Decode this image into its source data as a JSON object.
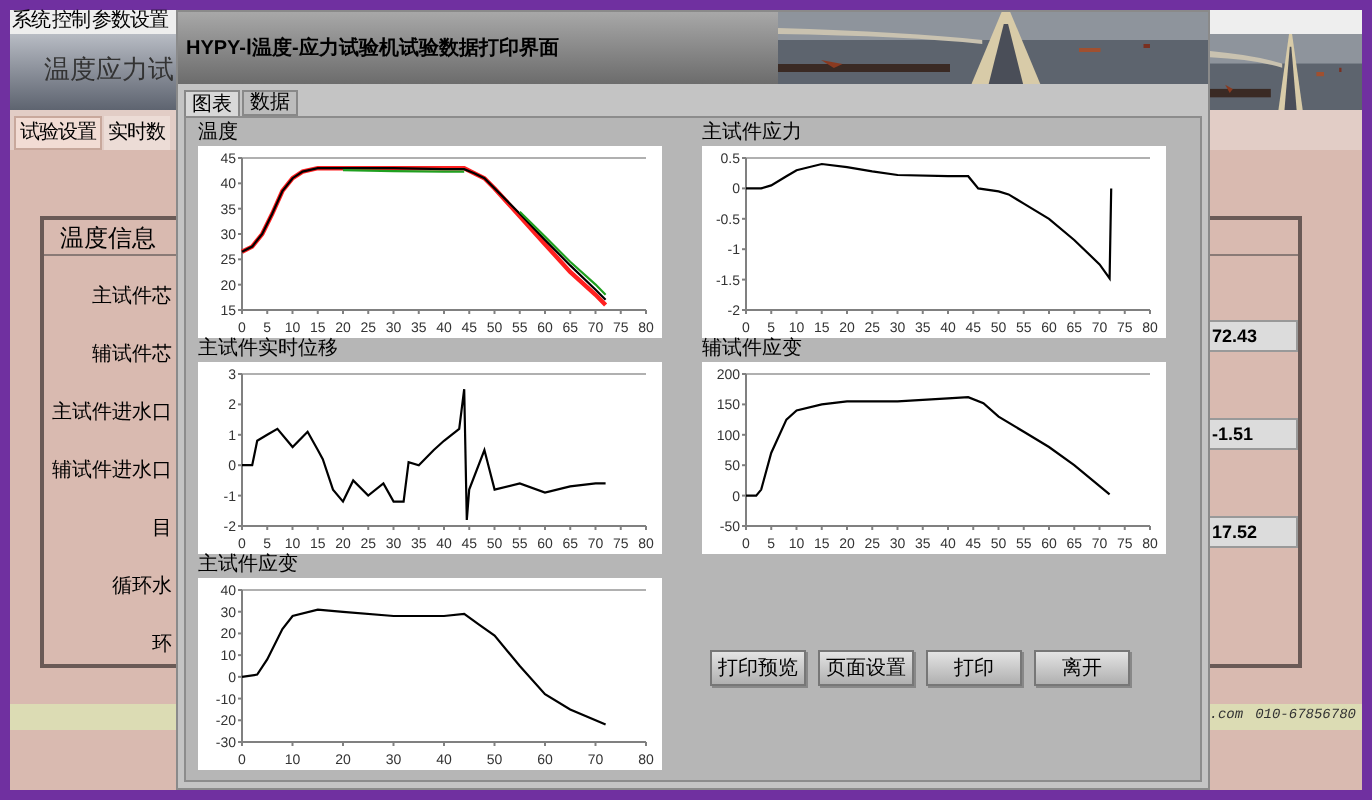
{
  "background_app": {
    "menu": [
      "系统",
      "控制",
      "参数设置"
    ],
    "title": "温度应力试",
    "tabs": [
      {
        "label": "试验设置",
        "selected": true
      },
      {
        "label": "实时数",
        "selected": false
      }
    ],
    "group_title": "温度信息",
    "labels": [
      "主试件芯",
      "辅试件芯",
      "主试件进水口",
      "辅试件进水口",
      "目",
      "循环水",
      "环"
    ],
    "values": [
      "72.43",
      "-1.51",
      "17.52"
    ],
    "status_bar": [
      ".com",
      "010-67856780"
    ]
  },
  "dialog": {
    "title": "HYPY-Ⅰ温度-应力试验机试验数据打印界面",
    "tabs": [
      {
        "label": "图表",
        "selected": true
      },
      {
        "label": "数据",
        "selected": false
      }
    ],
    "charts": [
      {
        "chart_data": {
          "type": "line",
          "title": "温度",
          "x": [
            0,
            2,
            4,
            6,
            8,
            10,
            12,
            15,
            20,
            30,
            40,
            44,
            46,
            48,
            50,
            55,
            60,
            65,
            70,
            72
          ],
          "series": [
            {
              "color": "#ff2020",
              "values": [
                26.5,
                27.5,
                30,
                34,
                38.5,
                41,
                42.3,
                43,
                43,
                43,
                43,
                43,
                42,
                41,
                39,
                33.5,
                28,
                22.5,
                18,
                16
              ]
            },
            {
              "color": "#000000",
              "values": [
                26.5,
                27.5,
                30,
                34,
                38.5,
                41,
                42.3,
                43,
                43,
                43,
                42.8,
                42.8,
                42,
                41,
                39,
                34,
                28.8,
                23.8,
                19,
                17
              ]
            },
            {
              "color": "#20a020",
              "values": [
                null,
                null,
                null,
                null,
                null,
                null,
                null,
                null,
                42.6,
                42.4,
                42.3,
                42.3,
                null,
                null,
                null,
                34.4,
                29.5,
                24.5,
                20,
                18
              ]
            }
          ],
          "xlim": [
            0,
            80
          ],
          "ylim": [
            15,
            45
          ],
          "xticks": [
            0,
            5,
            10,
            15,
            20,
            25,
            30,
            35,
            40,
            45,
            50,
            55,
            60,
            65,
            70,
            75,
            80
          ],
          "yticks": [
            15,
            20,
            25,
            30,
            35,
            40,
            45
          ]
        }
      },
      {
        "chart_data": {
          "type": "line",
          "title": "主试件实时位移",
          "x": [
            0,
            2,
            3,
            5,
            7,
            10,
            13,
            15,
            16,
            18,
            20,
            22,
            25,
            28,
            30,
            32,
            33,
            35,
            38,
            40,
            43,
            44,
            44.5,
            45,
            48,
            50,
            55,
            60,
            65,
            70,
            72
          ],
          "series": [
            {
              "color": "#000000",
              "values": [
                0,
                0,
                0.8,
                1.0,
                1.2,
                0.6,
                1.1,
                0.5,
                0.2,
                -0.8,
                -1.2,
                -0.5,
                -1.0,
                -0.6,
                -1.2,
                -1.2,
                0.1,
                0,
                0.5,
                0.8,
                1.2,
                2.5,
                -1.8,
                -0.8,
                0.5,
                -0.8,
                -0.6,
                -0.9,
                -0.7,
                -0.6,
                -0.6
              ]
            }
          ],
          "xlim": [
            0,
            80
          ],
          "ylim": [
            -2,
            3
          ],
          "xticks": [
            0,
            5,
            10,
            15,
            20,
            25,
            30,
            35,
            40,
            45,
            50,
            55,
            60,
            65,
            70,
            75,
            80
          ],
          "yticks": [
            -2,
            -1,
            0,
            1,
            2,
            3
          ]
        }
      },
      {
        "chart_data": {
          "type": "line",
          "title": "主试件应变",
          "x": [
            0,
            3,
            5,
            8,
            10,
            15,
            20,
            30,
            40,
            44,
            47,
            50,
            55,
            60,
            65,
            72
          ],
          "series": [
            {
              "color": "#000000",
              "values": [
                0,
                1,
                8,
                22,
                28,
                31,
                30,
                28,
                28,
                29,
                24,
                19,
                5,
                -8,
                -15,
                -22
              ]
            }
          ],
          "xlim": [
            0,
            80
          ],
          "ylim": [
            -30,
            40
          ],
          "xticks": [
            0,
            10,
            20,
            30,
            40,
            50,
            60,
            70,
            80
          ],
          "yticks": [
            -30,
            -20,
            -10,
            0,
            10,
            20,
            30,
            40
          ]
        }
      },
      {
        "chart_data": {
          "type": "line",
          "title": "主试件应力",
          "x": [
            0,
            3,
            5,
            8,
            10,
            15,
            20,
            25,
            30,
            40,
            44,
            46,
            50,
            52,
            55,
            60,
            65,
            70,
            72,
            72.3
          ],
          "series": [
            {
              "color": "#000000",
              "values": [
                0,
                0,
                0.05,
                0.2,
                0.3,
                0.4,
                0.35,
                0.28,
                0.22,
                0.2,
                0.2,
                0,
                -0.05,
                -0.1,
                -0.25,
                -0.5,
                -0.85,
                -1.25,
                -1.48,
                0
              ]
            }
          ],
          "xlim": [
            0,
            80
          ],
          "ylim": [
            -2,
            0.5
          ],
          "xticks": [
            0,
            5,
            10,
            15,
            20,
            25,
            30,
            35,
            40,
            45,
            50,
            55,
            60,
            65,
            70,
            75,
            80
          ],
          "yticks": [
            -2,
            -1.5,
            -1,
            -0.5,
            0,
            0.5
          ]
        }
      },
      {
        "chart_data": {
          "type": "line",
          "title": "辅试件应变",
          "x": [
            0,
            2,
            3,
            5,
            8,
            10,
            15,
            20,
            30,
            40,
            44,
            47,
            50,
            55,
            60,
            65,
            72
          ],
          "series": [
            {
              "color": "#000000",
              "values": [
                0,
                0,
                10,
                70,
                125,
                140,
                150,
                155,
                155,
                160,
                162,
                152,
                130,
                105,
                80,
                50,
                2
              ]
            }
          ],
          "xlim": [
            0,
            80
          ],
          "ylim": [
            -50,
            200
          ],
          "xticks": [
            0,
            5,
            10,
            15,
            20,
            25,
            30,
            35,
            40,
            45,
            50,
            55,
            60,
            65,
            70,
            75,
            80
          ],
          "yticks": [
            -50,
            0,
            50,
            100,
            150,
            200
          ]
        }
      }
    ],
    "buttons": [
      "打印预览",
      "页面设置",
      "打印",
      "离开"
    ]
  }
}
